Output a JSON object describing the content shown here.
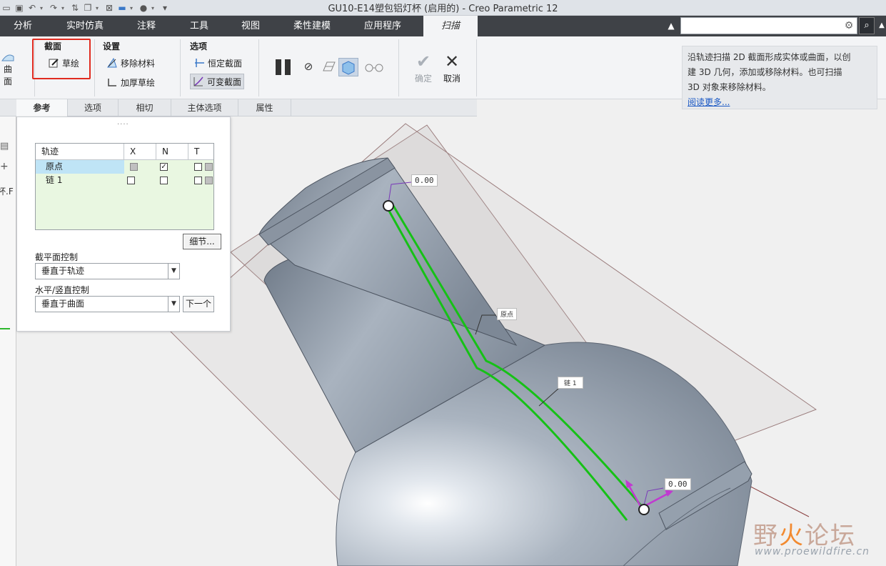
{
  "window": {
    "title": "GU10-E14塑包铝灯杯 (启用的) - Creo Parametric 12"
  },
  "ribbon_tabs": [
    "分析",
    "实时仿真",
    "注释",
    "工具",
    "视图",
    "柔性建模",
    "应用程序",
    "扫描"
  ],
  "search": {
    "placeholder": ""
  },
  "ribbon": {
    "left_partial_label": "曲面",
    "section_group": {
      "title": "截面",
      "sketch": "草绘"
    },
    "settings_group": {
      "title": "设置",
      "remove_material": "移除材料",
      "thicken_sketch": "加厚草绘"
    },
    "options_group": {
      "title": "选项",
      "constant_section": "恒定截面",
      "variable_section": "可变截面"
    },
    "confirm": "确定",
    "cancel": "取消"
  },
  "help_panel": {
    "text_line1": "沿轨迹扫描 2D 截面形成实体或曲面，以创",
    "text_line2": "建 3D 几何，添加或移除材料。也可扫描",
    "text_line3": "3D 对象来移除材料。",
    "link": "阅读更多..."
  },
  "sub_tabs": [
    "参考",
    "选项",
    "相切",
    "主体选项",
    "属性"
  ],
  "left_strip": {
    "partial_label": "杯.F"
  },
  "references_panel": {
    "grip": "....",
    "columns": [
      "轨迹",
      "X",
      "N",
      "T"
    ],
    "rows": [
      {
        "name": "原点",
        "x": "gray",
        "n": "checked"
      },
      {
        "name": "链 1",
        "x": "empty",
        "n": "empty"
      }
    ],
    "details_button": "细节...",
    "section_plane_label": "截平面控制",
    "section_plane_value": "垂直于轨迹",
    "hv_label": "水平/竖直控制",
    "hv_value": "垂直于曲面",
    "next_button": "下一个"
  },
  "viewport": {
    "dim_top": "0.00",
    "dim_bottom": "0.00",
    "label_origin": "原点",
    "label_chain": "链 1",
    "colors": {
      "trajectory": "#16c116",
      "body": "#a3abb7",
      "arrow": "#c03ad0"
    }
  },
  "watermark": {
    "big_a": "野",
    "big_fire": "火",
    "big_b": "论坛",
    "url": "www.proewildfire.cn"
  }
}
